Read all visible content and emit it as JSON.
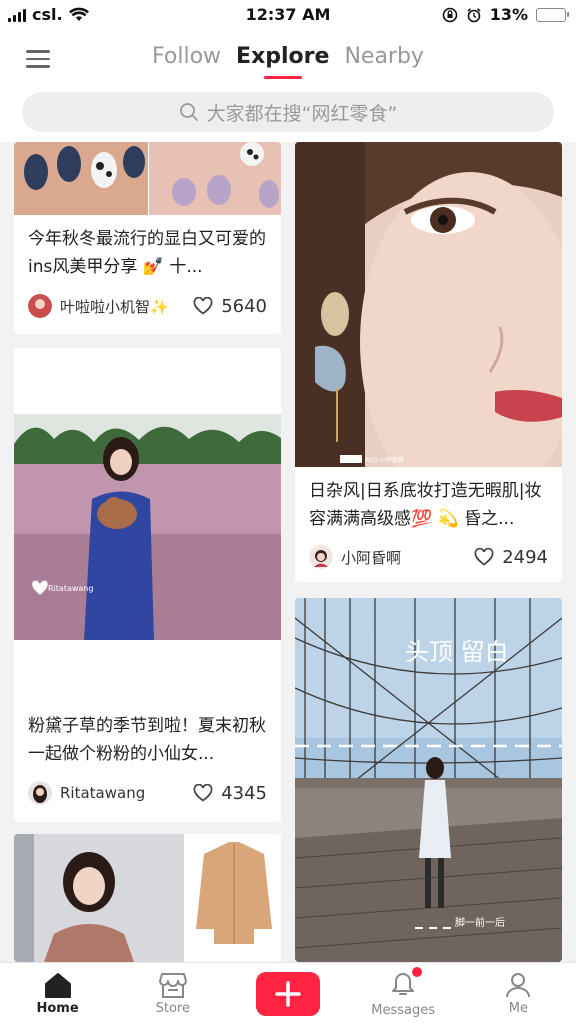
{
  "status_bar": {
    "carrier": "csl.",
    "time": "12:37 AM",
    "battery": "13%",
    "battery_fraction": 0.13
  },
  "header": {
    "tabs": [
      {
        "label": "Follow",
        "active": false
      },
      {
        "label": "Explore",
        "active": true
      },
      {
        "label": "Nearby",
        "active": false
      }
    ],
    "search_placeholder": "大家都在搜“网红零食”"
  },
  "feed": {
    "posts": [
      {
        "title": "今年秋冬最流行的显白又可爱的ins风美甲分享 💅 十...",
        "author": "叶啦啦小机智✨",
        "likes": "5640"
      },
      {
        "title": "日杂风|日系底妆打造无暇肌|妆容满满高级感💯 💫 昏之...",
        "author": "小阿昏啊",
        "likes": "2494"
      },
      {
        "title": "粉黛子草的季节到啦！夏末初秋一起做个粉粉的小仙女...",
        "author": "Ritatawang",
        "likes": "4345"
      }
    ],
    "image_overlay_texts": {
      "flower_watermark": "Ritatawang",
      "bridge_title": "头顶 留白",
      "bridge_caption": "脚一前一后",
      "makeup_tag": "RED 小阿昏啊"
    }
  },
  "tabbar": {
    "items": [
      {
        "label": "Home",
        "icon": "home-icon",
        "active": true
      },
      {
        "label": "Store",
        "icon": "store-icon",
        "active": false
      },
      {
        "label": "",
        "icon": "plus-icon",
        "active": false
      },
      {
        "label": "Messages",
        "icon": "bell-icon",
        "active": false
      },
      {
        "label": "Me",
        "icon": "person-icon",
        "active": false
      }
    ]
  },
  "colors": {
    "accent": "#ff2442",
    "background": "#f2f2f2"
  }
}
